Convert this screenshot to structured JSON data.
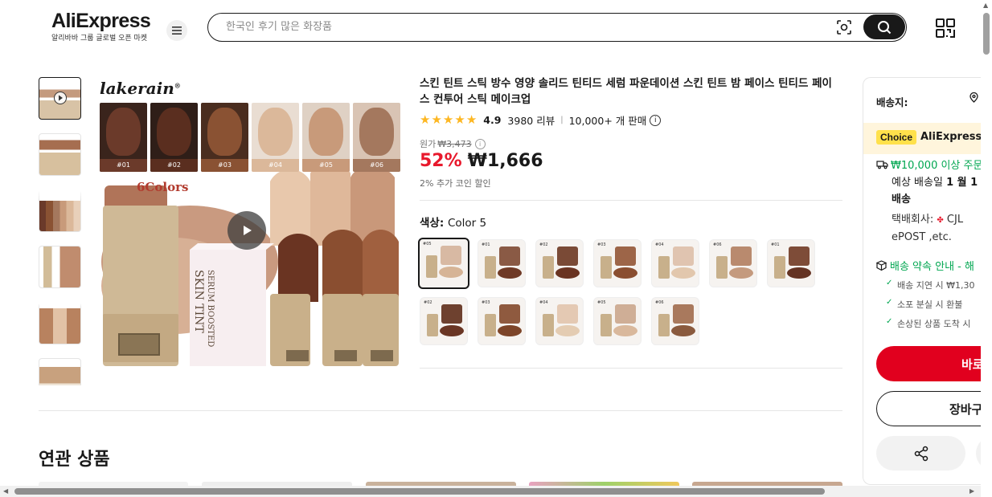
{
  "header": {
    "logo_text": "AliExpress",
    "logo_subtext": "알리바바 그룹 글로벌 오픈 마켓",
    "search_placeholder": "한국인 후기 많은 화장품"
  },
  "product": {
    "title": "스킨 틴트 스틱 방수 영양 솔리드 틴티드 세럼 파운데이션 스킨 틴트 밤 페이스 틴티드 페이스 컨투어 스틱 메이크업",
    "rating": "4.9",
    "reviews": "3980 리뷰",
    "sold": "10,000+ 개 판매",
    "original_label": "원가",
    "original_price": "₩3,473",
    "discount": "52%",
    "price": "₩1,666",
    "coin_note": "2% 추가 코인 할인",
    "color_label": "색상:",
    "color_value": "Color 5"
  },
  "image": {
    "brand": "lakerain",
    "brand_mark": "®",
    "colors_label": "6Colors",
    "product_label_1": "SERUM BOOSTED",
    "product_label_2": "SKIN TINT",
    "swatches": [
      {
        "label": "#01",
        "color": "#6b3a2a"
      },
      {
        "label": "#02",
        "color": "#5a2e1f"
      },
      {
        "label": "#03",
        "color": "#8a5233"
      },
      {
        "label": "#04",
        "color": "#dbb89a"
      },
      {
        "label": "#05",
        "color": "#c89a7a"
      },
      {
        "label": "#06",
        "color": "#a4785e"
      }
    ]
  },
  "color_options": [
    {
      "tag": "#05",
      "face": "#d8b9a3",
      "smear": "#d6b496"
    },
    {
      "tag": "#01",
      "face": "#8a5a45",
      "smear": "#6f3a26"
    },
    {
      "tag": "#02",
      "face": "#7a4a36",
      "smear": "#6a3422"
    },
    {
      "tag": "#03",
      "face": "#9d6548",
      "smear": "#8a4e30"
    },
    {
      "tag": "#04",
      "face": "#e0c4b0",
      "smear": "#e2c7ad"
    },
    {
      "tag": "#06",
      "face": "#b98a6e",
      "smear": "#c49a7e"
    },
    {
      "tag": "#01",
      "face": "#7e4c38",
      "smear": "#643323"
    },
    {
      "tag": "#02",
      "face": "#6e412f",
      "smear": "#6a3624"
    },
    {
      "tag": "#03",
      "face": "#8f5a3f",
      "smear": "#7d4529"
    },
    {
      "tag": "#04",
      "face": "#e4c9b3",
      "smear": "#e4ccb2"
    },
    {
      "tag": "#05",
      "face": "#cfae96",
      "smear": "#d9b89c"
    },
    {
      "tag": "#06",
      "face": "#a9795d",
      "smear": "#8a5a3e"
    }
  ],
  "related_title": "연관 상품",
  "panel": {
    "ship_to": "배송지:",
    "choice_badge": "Choice",
    "choice_text": "AliExpress",
    "free_ship": "₩10,000 이상 주문",
    "eta_1": "예상 배송일 ",
    "eta_bold": "1 월 1",
    "eta_2": "배송",
    "carrier_label": "택배회사:",
    "carrier_name": "CJL",
    "carrier_2": "ePOST ,etc.",
    "promise": "배송 약속 안내 - 해",
    "promise_items": [
      "배송 지연 시 ₩1,30",
      "소포 분실 시 환불",
      "손상된 상품 도착 시"
    ],
    "buy_label": "바로",
    "cart_label": "장바구"
  }
}
